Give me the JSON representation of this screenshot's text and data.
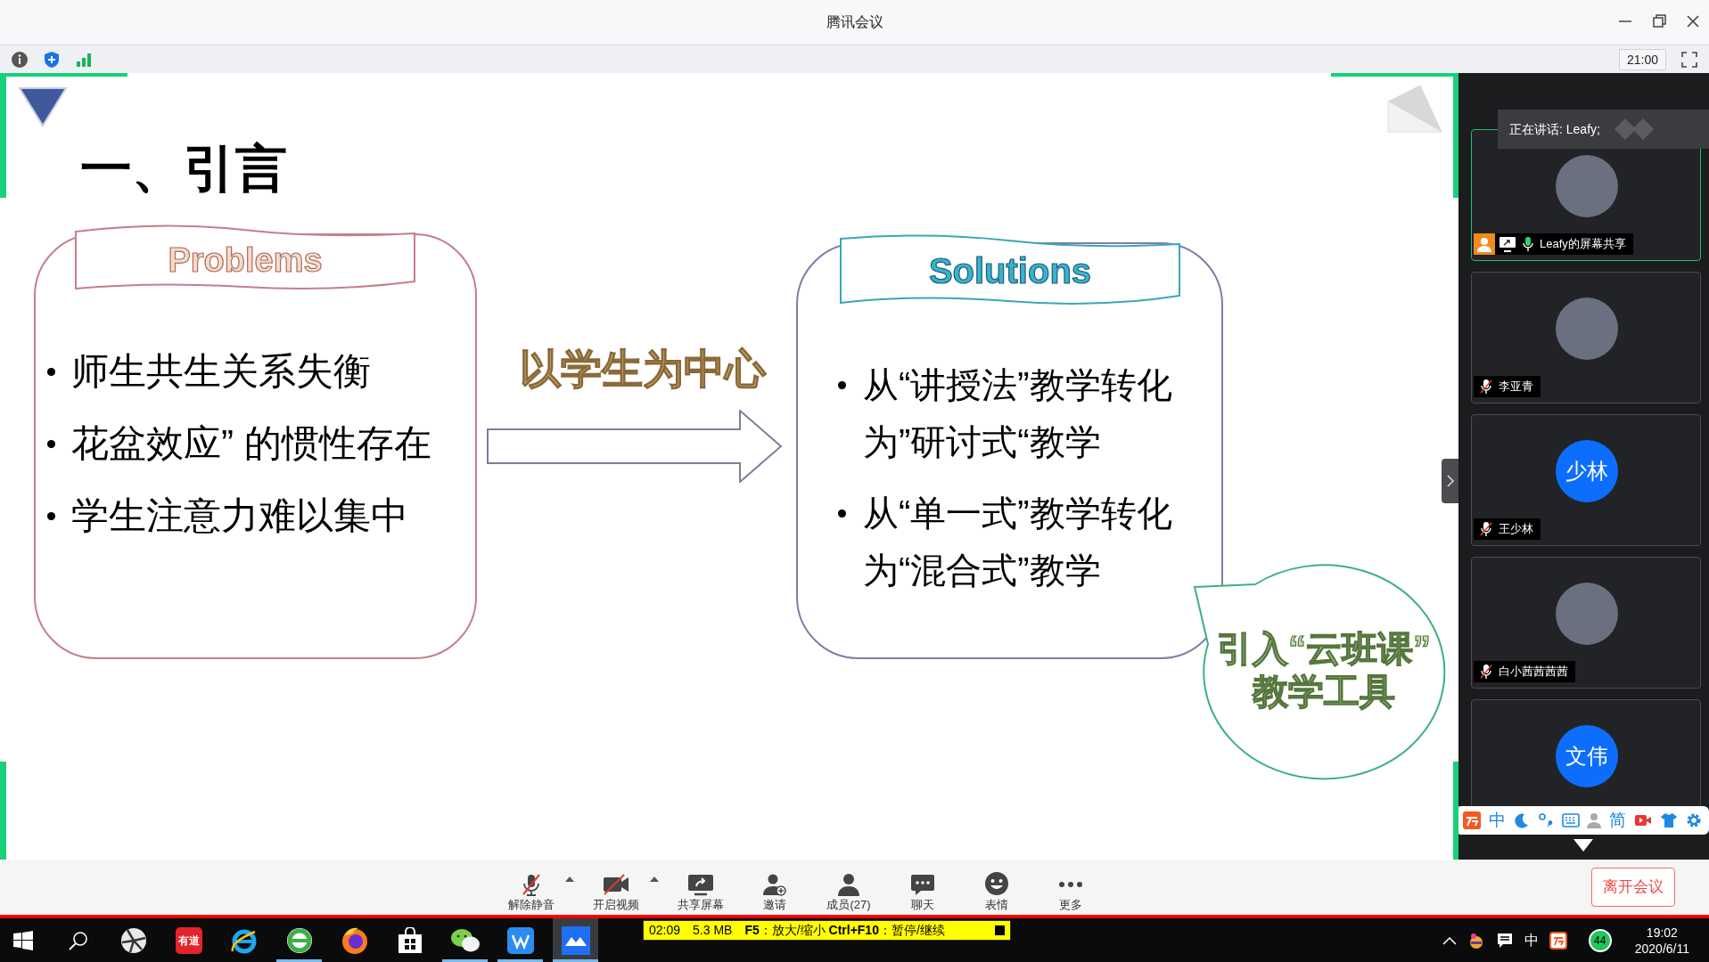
{
  "window": {
    "title": "腾讯会议"
  },
  "info_bar": {
    "meeting_time": "21:00"
  },
  "slide": {
    "title": "一、引言",
    "problems": {
      "heading": "Problems",
      "bullets": [
        "师生共生关系失衡",
        "花盆效应” 的惯性存在",
        "学生注意力难以集中"
      ]
    },
    "arrow_label": "以学生为中心",
    "solutions": {
      "heading": "Solutions",
      "bullets": [
        "从“讲授法”教学转化为”研讨式“教学",
        "从“单一式”教学转化为“混合式”教学"
      ]
    },
    "callout": {
      "lines": [
        "引入“云班课”",
        "教学工具"
      ]
    }
  },
  "speaking_banner": "正在讲话: Leafy;",
  "participants": [
    {
      "name": "Leafy的屏幕共享",
      "kind": "photo",
      "speaking": true,
      "muted": false,
      "sharing": true
    },
    {
      "name": "李亚青",
      "kind": "photo",
      "speaking": false,
      "muted": true,
      "sharing": false
    },
    {
      "name": "王少林",
      "kind": "initials",
      "initials": "少林",
      "speaking": false,
      "muted": true,
      "sharing": false
    },
    {
      "name": "白小茜茜茜茜",
      "kind": "photo",
      "speaking": false,
      "muted": true,
      "sharing": false
    },
    {
      "kind": "initials",
      "initials": "文伟",
      "speaking": false
    }
  ],
  "ime_toolbar": [
    {
      "kind": "logo"
    },
    {
      "kind": "text",
      "text": "中"
    },
    {
      "kind": "moon"
    },
    {
      "kind": "punct"
    },
    {
      "kind": "keyboard"
    },
    {
      "kind": "user"
    },
    {
      "kind": "text",
      "text": "简"
    },
    {
      "kind": "video"
    },
    {
      "kind": "skin"
    },
    {
      "kind": "settings"
    }
  ],
  "toolbar": {
    "buttons": [
      {
        "kind": "mic",
        "label": "解除静音",
        "caret": true
      },
      {
        "kind": "video",
        "label": "开启视频",
        "caret": true
      },
      {
        "kind": "share",
        "label": "共享屏幕",
        "caret": false
      },
      {
        "kind": "invite",
        "label": "邀请",
        "caret": false
      },
      {
        "kind": "members",
        "label": "成员(27)",
        "caret": false
      },
      {
        "kind": "chat",
        "label": "聊天",
        "caret": false
      },
      {
        "kind": "emoji",
        "label": "表情",
        "caret": false
      },
      {
        "kind": "more",
        "label": "更多",
        "caret": false
      }
    ],
    "leave_button": "离开会议"
  },
  "taskbar": {
    "apps": [
      {
        "kind": "start",
        "running": false,
        "selected": false
      },
      {
        "kind": "search",
        "running": false,
        "selected": false
      },
      {
        "kind": "pinwheel",
        "running": false,
        "selected": false
      },
      {
        "kind": "youdao",
        "label": "有道",
        "running": false,
        "selected": false
      },
      {
        "kind": "ie",
        "running": false,
        "selected": false
      },
      {
        "kind": "browser",
        "running": true,
        "selected": false
      },
      {
        "kind": "firefox",
        "running": false,
        "selected": false
      },
      {
        "kind": "store",
        "running": false,
        "selected": false
      },
      {
        "kind": "wechat",
        "running": true,
        "selected": false
      },
      {
        "kind": "wps",
        "running": true,
        "selected": false
      },
      {
        "kind": "meeting",
        "running": true,
        "selected": true
      }
    ],
    "recording_bar": {
      "elapsed": "02:09",
      "size": "5.3 MB",
      "hint": "**F5**：放大/缩小 **Ctrl+F10**：暂停/继续"
    },
    "tray": {
      "ime": "中",
      "badge": "44",
      "time": "19:02",
      "date": "2020/6/11"
    }
  }
}
